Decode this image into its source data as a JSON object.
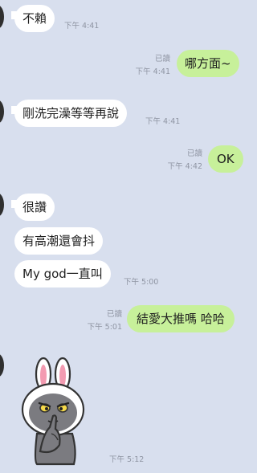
{
  "messages": [
    {
      "id": "m1",
      "side": "in",
      "text": "不賴",
      "time": "下午 4:41"
    },
    {
      "id": "m2",
      "side": "out",
      "text": "哪方面~",
      "read": "已讀",
      "time": "下午 4:41"
    },
    {
      "id": "m3",
      "side": "in",
      "text": "剛洗完澡等等再說",
      "time": "下午 4:41"
    },
    {
      "id": "m4",
      "side": "out",
      "text": "OK",
      "read": "已讀",
      "time": "下午 4:42"
    },
    {
      "id": "m5",
      "side": "in",
      "text": "很讚"
    },
    {
      "id": "m6",
      "side": "in",
      "text": "有高潮還會抖"
    },
    {
      "id": "m7",
      "side": "in",
      "text": "My god一直叫",
      "time": "下午 5:00"
    },
    {
      "id": "m8",
      "side": "out",
      "text": "結愛大推嗎 哈哈",
      "read": "已讀",
      "time": "下午 5:01"
    },
    {
      "id": "m9",
      "side": "in",
      "sticker": "cony-rabbit-shush-sticker",
      "time": "下午 5:12"
    }
  ]
}
